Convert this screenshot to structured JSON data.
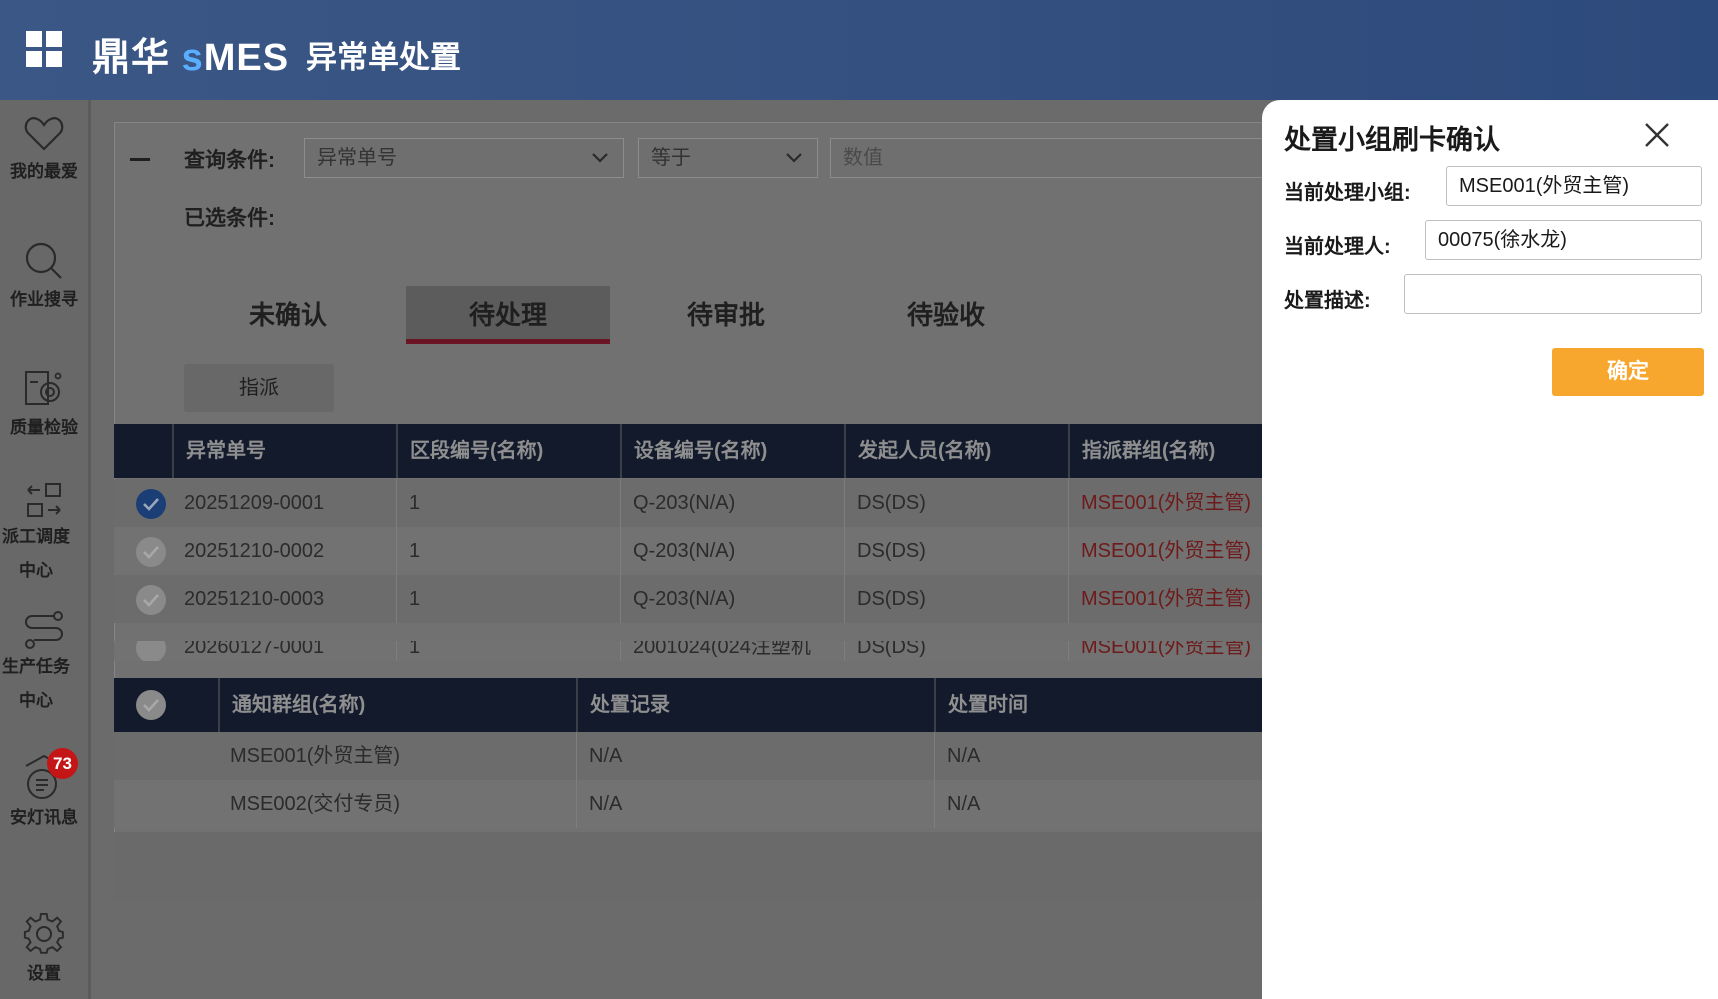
{
  "header": {
    "brand_cn": "鼎华",
    "brand_s": "s",
    "brand_mes": "MES",
    "title": "异常单处置"
  },
  "sidebar": {
    "items": [
      {
        "label": "我的最爱",
        "icon": "heart-icon"
      },
      {
        "label": "作业搜寻",
        "icon": "search-icon"
      },
      {
        "label": "质量检验",
        "icon": "quality-inspection-icon"
      },
      {
        "label": "派工调度中心",
        "icon": "dispatch-icon"
      },
      {
        "label": "生产任务中心",
        "icon": "task-flow-icon"
      },
      {
        "label": "安灯讯息",
        "icon": "andon-message-icon",
        "badge": "73"
      },
      {
        "label": "设置",
        "icon": "gear-icon"
      }
    ]
  },
  "query": {
    "label": "查询条件:",
    "field": "异常单号",
    "operator": "等于",
    "value_placeholder": "数值",
    "selected_label": "已选条件:"
  },
  "tabs": [
    {
      "label": "未确认",
      "active": false
    },
    {
      "label": "待处理",
      "active": true
    },
    {
      "label": "待审批",
      "active": false
    },
    {
      "label": "待验收",
      "active": false
    }
  ],
  "assign_button": "指派",
  "exception_table": {
    "headers": [
      "异常单号",
      "区段编号(名称)",
      "设备编号(名称)",
      "发起人员(名称)",
      "指派群组(名称)"
    ],
    "rows": [
      {
        "selected": true,
        "cells": [
          "20251209-0001",
          "1",
          "Q-203(N/A)",
          "DS(DS)",
          "MSE001(外贸主管)"
        ]
      },
      {
        "selected": false,
        "cells": [
          "20251210-0002",
          "1",
          "Q-203(N/A)",
          "DS(DS)",
          "MSE001(外贸主管)"
        ]
      },
      {
        "selected": false,
        "cells": [
          "20251210-0003",
          "1",
          "Q-203(N/A)",
          "DS(DS)",
          "MSE001(外贸主管)"
        ]
      },
      {
        "selected": false,
        "cells": [
          "20260127-0001",
          "1",
          "2001024(024注塑机",
          "DS(DS)",
          "MSE001(外贸主管)"
        ]
      }
    ]
  },
  "notify_table": {
    "headers": [
      "通知群组(名称)",
      "处置记录",
      "处置时间"
    ],
    "rows": [
      [
        "MSE001(外贸主管)",
        "N/A",
        "N/A"
      ],
      [
        "MSE002(交付专员)",
        "N/A",
        "N/A"
      ]
    ]
  },
  "dialog": {
    "title": "处置小组刷卡确认",
    "group_label": "当前处理小组:",
    "group_value": "MSE001(外贸主管)",
    "handler_label": "当前处理人:",
    "handler_value": "00075(徐水龙)",
    "desc_label": "处置描述:",
    "desc_value": "",
    "confirm": "确定"
  },
  "colors": {
    "header": "#2d4a7c",
    "accent_orange": "#f7a72e",
    "badge_red": "#c41616"
  }
}
